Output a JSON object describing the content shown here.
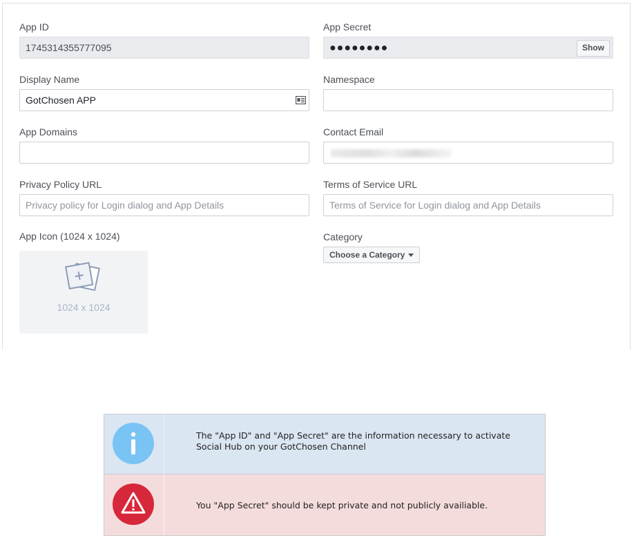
{
  "form": {
    "app_id": {
      "label": "App ID",
      "value": "1745314355777095"
    },
    "app_secret": {
      "label": "App Secret",
      "masked": "●●●●●●●●",
      "show_label": "Show"
    },
    "display_name": {
      "label": "Display Name",
      "value": "GotChosen APP"
    },
    "namespace": {
      "label": "Namespace",
      "value": ""
    },
    "app_domains": {
      "label": "App Domains",
      "value": ""
    },
    "contact_email": {
      "label": "Contact Email"
    },
    "privacy_url": {
      "label": "Privacy Policy URL",
      "placeholder": "Privacy policy for Login dialog and App Details"
    },
    "terms_url": {
      "label": "Terms of Service URL",
      "placeholder": "Terms of Service for Login dialog and App Details"
    },
    "app_icon": {
      "label": "App Icon (1024 x 1024)",
      "size_text": "1024 x 1024"
    },
    "category": {
      "label": "Category",
      "button_label": "Choose a Category"
    }
  },
  "notices": {
    "info": {
      "text": "The \"App ID\" and \"App Secret\" are the information necessary to activate Social Hub on your GotChosen Channel",
      "icon": "info-icon"
    },
    "warning": {
      "text": "You \"App Secret\" should be kept private and not publicly availiable.",
      "icon": "warning-icon"
    }
  },
  "colors": {
    "info_bg": "#dae6f2",
    "info_icon": "#79c3f5",
    "warning_bg": "#f5dcdc",
    "warning_icon": "#d7273a"
  }
}
